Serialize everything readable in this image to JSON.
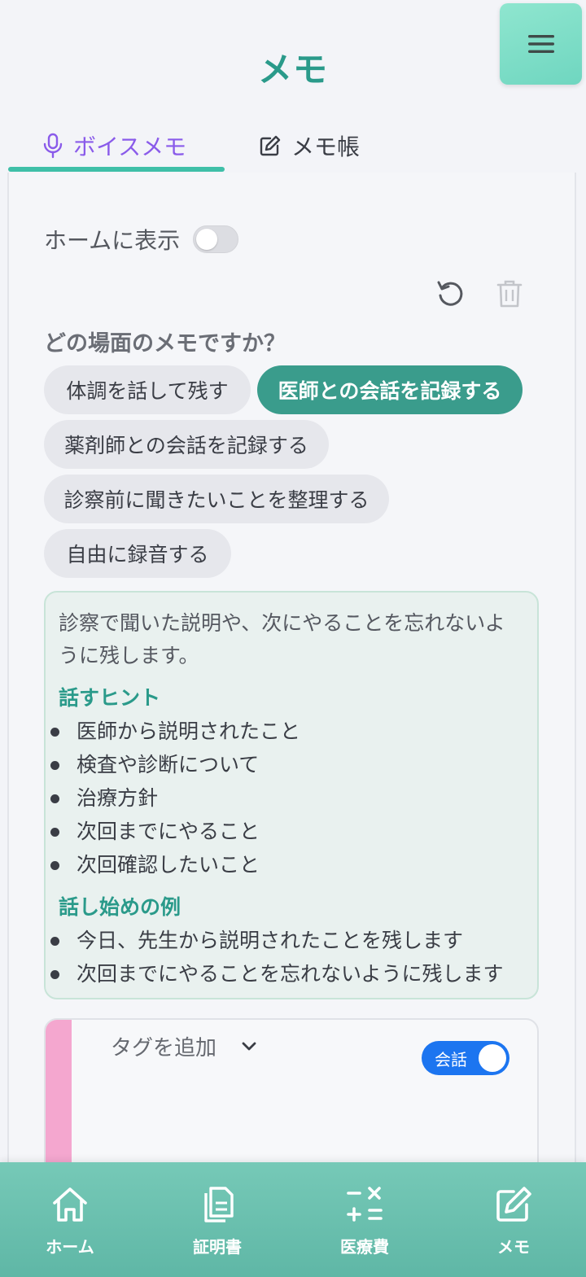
{
  "header": {
    "title": "メモ",
    "menu_icon": "hamburger-menu-icon"
  },
  "tabs": [
    {
      "label": "ボイスメモ",
      "icon": "microphone-icon",
      "active": true
    },
    {
      "label": "メモ帳",
      "icon": "edit-icon",
      "active": false
    }
  ],
  "settings": {
    "show_on_home_label": "ホームに表示",
    "show_on_home": false
  },
  "toolbar": {
    "reset_icon": "undo-icon",
    "delete_icon": "trash-icon"
  },
  "scene": {
    "question": "どの場面のメモですか？",
    "options": [
      {
        "label": "体調を話して残す",
        "selected": false
      },
      {
        "label": "医師との会話を記録する",
        "selected": true
      },
      {
        "label": "薬剤師との会話を記録する",
        "selected": false
      },
      {
        "label": "診察前に聞きたいことを整理する",
        "selected": false
      },
      {
        "label": "自由に録音する",
        "selected": false
      }
    ]
  },
  "hint": {
    "description": "診察で聞いた説明や、次にやることを忘れないように残します。",
    "tips_heading": "話すヒント",
    "tips": [
      "医師から説明されたこと",
      "検査や診断について",
      "治療方針",
      "次回までにやること",
      "次回確認したいこと"
    ],
    "examples_heading": "話し始めの例",
    "examples": [
      "今日、先生から説明されたことを残します",
      "次回までにやることを忘れないように残します"
    ]
  },
  "memo_card": {
    "tag_add_label": "タグを追加",
    "conversation_toggle_label": "会話",
    "conversation_toggle_on": true,
    "accent_color": "#f4a7cf"
  },
  "bottom_nav": [
    {
      "label": "ホーム",
      "icon": "home-icon"
    },
    {
      "label": "証明書",
      "icon": "documents-icon"
    },
    {
      "label": "医療費",
      "icon": "calculator-icon"
    },
    {
      "label": "メモ",
      "icon": "edit-icon"
    }
  ],
  "colors": {
    "brand_teal": "#2a9a8a",
    "active_tab": "#8a5bea",
    "selected_chip": "#3a9c8c",
    "toggle_on": "#1c75f0"
  }
}
